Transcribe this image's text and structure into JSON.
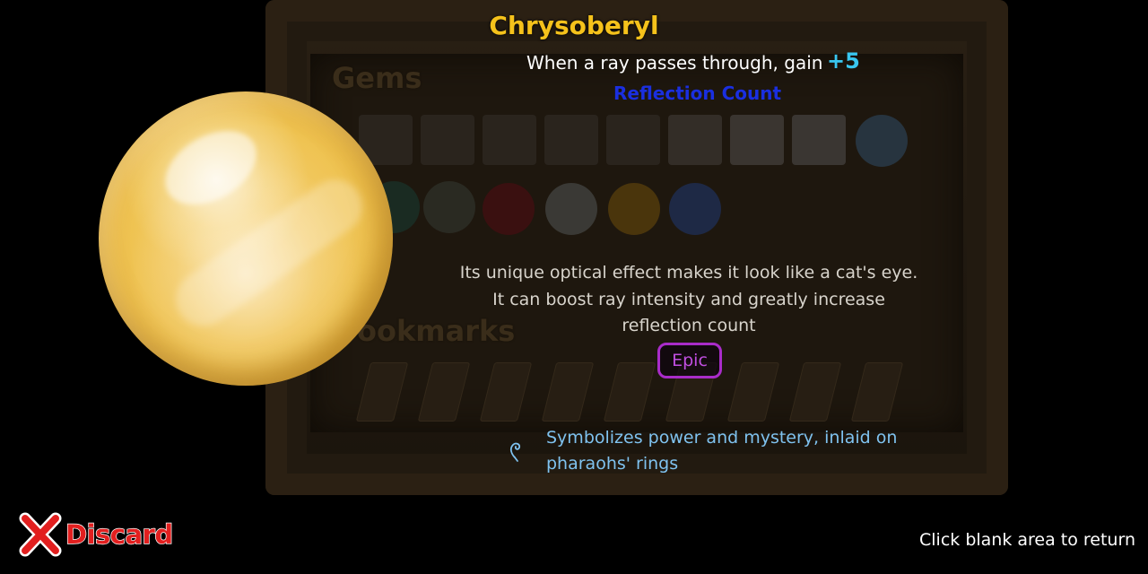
{
  "board": {
    "gems_title": "Gems",
    "bookmarks_title": "ookmarks"
  },
  "gem": {
    "name": "Chrysoberyl",
    "effect_text": "When a ray passes through, gain",
    "effect_value": "+5",
    "effect_stat": "Reflection Count",
    "description": "Its unique optical effect makes it look like a cat's eye. It can boost ray intensity and greatly increase reflection count",
    "rarity": "Epic",
    "lore_icon": "swirl-icon",
    "lore": "Symbolizes power and mystery, inlaid on pharaohs' rings"
  },
  "actions": {
    "discard_label": "Discard",
    "discard_icon": "close-x-icon",
    "return_hint": "Click blank area to return"
  },
  "colors": {
    "gem_name": "#f5c21b",
    "effect_value": "#39c6f0",
    "effect_stat": "#1a2fe0",
    "rarity": "#a92cc9",
    "lore": "#7fc2ef",
    "discard": "#e21f1f"
  }
}
